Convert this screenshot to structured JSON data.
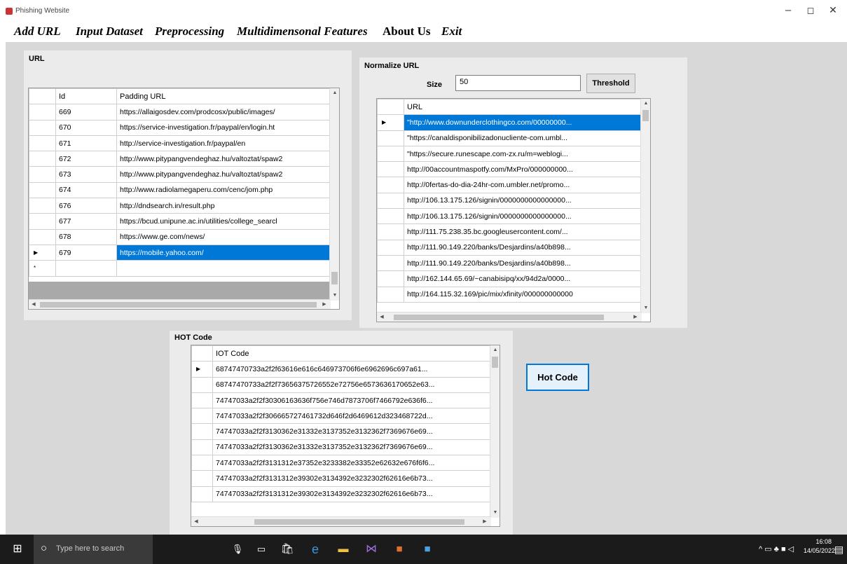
{
  "window": {
    "title": "Phishing Website",
    "minimize": "–",
    "maximize": "◻",
    "close": "✕"
  },
  "menu": [
    "Add URL",
    "Input Dataset",
    "Preprocessing",
    "Multidimensonal Features",
    "About Us",
    "Exit"
  ],
  "url_panel": {
    "label": "URL",
    "columns": [
      "Id",
      "Padding URL"
    ],
    "rows": [
      [
        "669",
        "https://allaigosdev.com/prodcosx/public/images/"
      ],
      [
        "670",
        "https://service-investigation.fr/paypal/en/login.ht"
      ],
      [
        "671",
        "http://service-investigation.fr/paypal/en"
      ],
      [
        "672",
        "http://www.pitypangvendeghaz.hu/valtoztat/spaw2"
      ],
      [
        "673",
        "http://www.pitypangvendeghaz.hu/valtoztat/spaw2"
      ],
      [
        "674",
        "http://www.radiolamegaperu.com/cenc/jom.php"
      ],
      [
        "676",
        "http://dndsearch.in/result.php"
      ],
      [
        "677",
        "https://bcud.unipune.ac.in/utilities/college_searcl"
      ],
      [
        "678",
        "https://www.ge.com/news/"
      ],
      [
        "679",
        "https://mobile.yahoo.com/"
      ]
    ],
    "selected_index": 9,
    "new_row_marker": "*"
  },
  "normalize_panel": {
    "label": "Normalize URL",
    "size_label": "Size",
    "size_value": "50",
    "threshold_button": "Threshold",
    "column": "URL",
    "rows": [
      "\"http://www.downunderclothingco.com/00000000...",
      "\"https://canaldisponibilizadonucliente-com.umbl...",
      "\"https://secure.runescape.com-zx.ru/m=weblogi...",
      "http://00accountmaspotfy.com/MxPro/000000000...",
      "http://0fertas-do-dia-24hr-com.umbler.net/promo...",
      "http://106.13.175.126/signin/0000000000000000...",
      "http://106.13.175.126/signin/0000000000000000...",
      "http://111.75.238.35.bc.googleusercontent.com/...",
      "http://111.90.149.220/banks/Desjardins/a40b898...",
      "http://111.90.149.220/banks/Desjardins/a40b898...",
      "http://162.144.65.69/~canabisipq/xx/94d2a/0000...",
      "http://164.115.32.169/pic/mix/xfinity/000000000000"
    ],
    "selected_index": 0
  },
  "hot_panel": {
    "label": "HOT Code",
    "column": "IOT Code",
    "rows": [
      "68747470733a2f2f63616e616c646973706f6e6962696c697a61...",
      "68747470733a2f2f73656375726552e72756e6573636170652e63...",
      "74747033a2f2f30306163636f756e746d7873706f7466792e636f6...",
      "74747033a2f2f306665727461732d646f2d6469612d323468722d...",
      "74747033a2f2f3130362e31332e3137352e3132362f7369676e69...",
      "74747033a2f2f3130362e31332e3137352e3132362f7369676e69...",
      "74747033a2f2f3131312e37352e3233382e33352e62632e676f6f6...",
      "74747033a2f2f3131312e39302e3134392e3232302f62616e6b73...",
      "74747033a2f2f3131312e39302e3134392e3232302f62616e6b73..."
    ],
    "hot_button": "Hot Code"
  },
  "taskbar": {
    "search_placeholder": "Type here to search",
    "time": "16:08",
    "date": "14/05/2022"
  }
}
